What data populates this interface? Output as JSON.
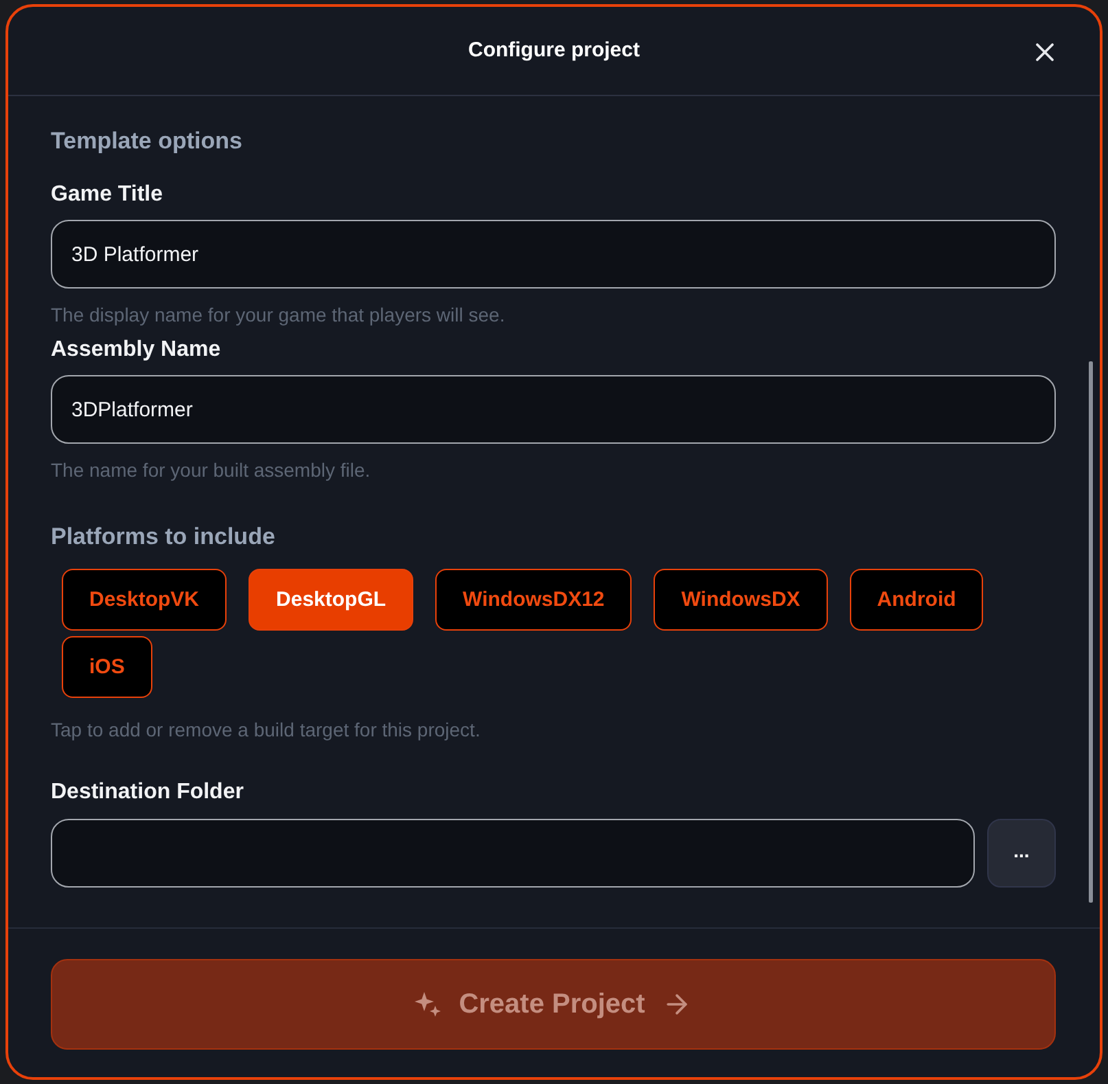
{
  "dialog": {
    "title": "Configure project"
  },
  "section": {
    "title": "Template options"
  },
  "fields": [
    {
      "label": "Game Title",
      "value": "3D Platformer",
      "help": "The display name for your game that players will see."
    },
    {
      "label": "Assembly Name",
      "value": "3DPlatformer",
      "help": "The name for your built assembly file."
    }
  ],
  "platforms": {
    "title": "Platforms to include",
    "items": [
      {
        "label": "DesktopVK",
        "selected": false
      },
      {
        "label": "DesktopGL",
        "selected": true
      },
      {
        "label": "WindowsDX12",
        "selected": false
      },
      {
        "label": "WindowsDX",
        "selected": false
      },
      {
        "label": "Android",
        "selected": false
      },
      {
        "label": "iOS",
        "selected": false
      }
    ],
    "help": "Tap to add or remove a build target for this project."
  },
  "destination": {
    "label": "Destination Folder",
    "browse_label": "..."
  },
  "create_button": {
    "label": "Create Project",
    "disabled": true
  }
}
